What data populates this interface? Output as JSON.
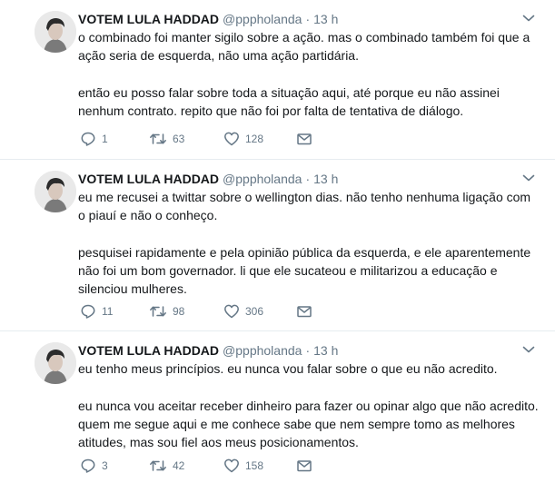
{
  "tweets": [
    {
      "author_name": "VOTEM LULA HADDAD",
      "handle": "@pppholanda",
      "separator": "·",
      "time": "13 h",
      "lines": [
        "o combinado foi manter sigilo sobre a ação. mas o combinado também foi que a",
        "ação seria de esquerda, não uma ação partidária.",
        "",
        "então eu posso falar sobre toda a situação aqui, até porque eu não assinei",
        "nenhum contrato. repito que não foi por falta de tentativa de diálogo."
      ],
      "replies": "1",
      "retweets": "63",
      "likes": "128"
    },
    {
      "author_name": "VOTEM LULA HADDAD",
      "handle": "@pppholanda",
      "separator": "·",
      "time": "13 h",
      "lines": [
        "eu me recusei a twittar sobre o wellington dias. não tenho nenhuma ligação com",
        "o piauí e não o conheço.",
        "",
        "pesquisei rapidamente e pela opinião pública da esquerda, e ele aparentemente",
        "não foi um bom governador. li que ele sucateou e militarizou a educação e",
        "silenciou mulheres."
      ],
      "replies": "11",
      "retweets": "98",
      "likes": "306"
    },
    {
      "author_name": "VOTEM LULA HADDAD",
      "handle": "@pppholanda",
      "separator": "·",
      "time": "13 h",
      "lines": [
        "eu tenho meus princípios. eu nunca vou falar sobre o que eu não acredito.",
        "",
        "eu nunca vou aceitar receber dinheiro para fazer ou opinar algo que não acredito.",
        "quem me segue aqui e me conhece sabe que nem sempre tomo as melhores",
        "atitudes, mas sou fiel aos meus posicionamentos."
      ],
      "replies": "3",
      "retweets": "42",
      "likes": "158"
    }
  ],
  "icons": {
    "reply": "reply-icon",
    "retweet": "retweet-icon",
    "like": "heart-icon",
    "dm": "envelope-icon",
    "caret": "chevron-down-icon"
  },
  "colors": {
    "text": "#14171a",
    "secondary": "#657786",
    "divider": "#e6ecf0"
  }
}
